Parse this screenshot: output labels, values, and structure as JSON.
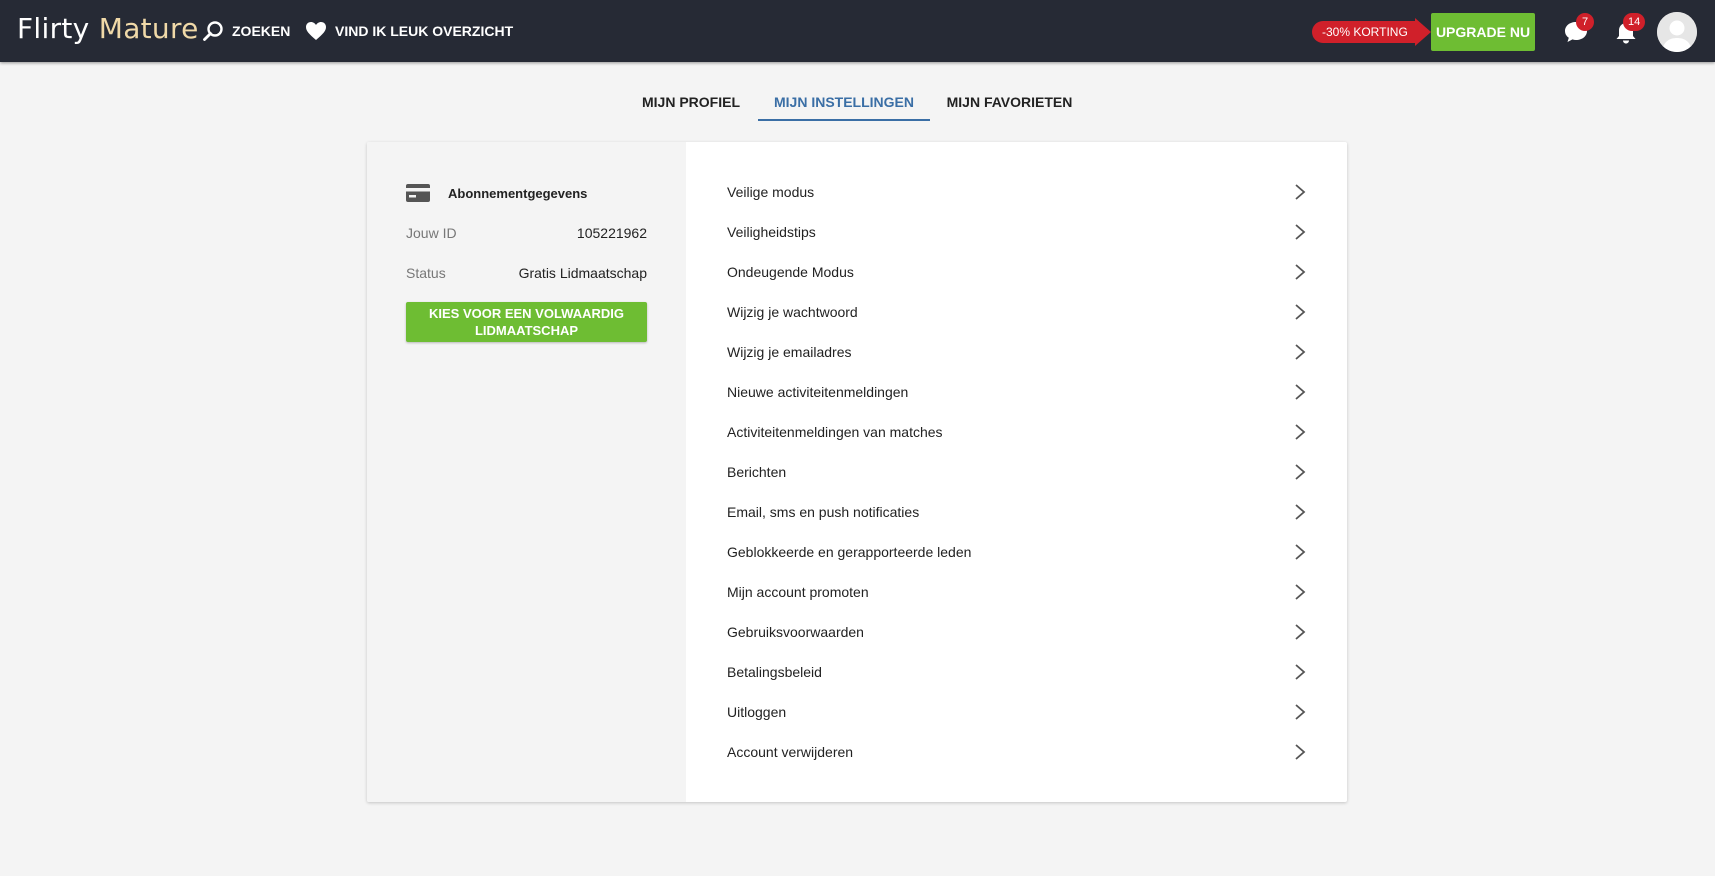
{
  "header": {
    "logo_main": "Flirty ",
    "logo_accent": "Mature",
    "nav": [
      {
        "label": "ZOEKEN",
        "icon": "search-icon"
      },
      {
        "label": "VIND IK LEUK OVERZICHT",
        "icon": "heart-icon"
      }
    ],
    "discount_label": "-30% KORTING",
    "upgrade_label": "UPGRADE NU",
    "messages_count": "7",
    "notifications_count": "14"
  },
  "tabs": [
    {
      "label": "MIJN PROFIEL",
      "active": false
    },
    {
      "label": "MIJN INSTELLINGEN",
      "active": true
    },
    {
      "label": "MIJN FAVORIETEN",
      "active": false
    }
  ],
  "subscription": {
    "heading": "Abonnementgegevens",
    "id_label": "Jouw ID",
    "id_value": "105221962",
    "status_label": "Status",
    "status_value": "Gratis Lidmaatschap",
    "button_label": "KIES VOOR EEN VOLWAARDIG LIDMAATSCHAP"
  },
  "settings": [
    "Veilige modus",
    "Veiligheidstips",
    "Ondeugende Modus",
    "Wijzig je wachtwoord",
    "Wijzig je emailadres",
    "Nieuwe activiteitenmeldingen",
    "Activiteitenmeldingen van matches",
    "Berichten",
    "Email, sms en push notificaties",
    "Geblokkeerde en gerapporteerde leden",
    "Mijn account promoten",
    "Gebruiksvoorwaarden",
    "Betalingsbeleid",
    "Uitloggen",
    "Account verwijderen"
  ],
  "colors": {
    "topbar": "#262a35",
    "accent_green": "#6ebd33",
    "badge_red": "#d0202a",
    "active_tab": "#3a6ea5"
  }
}
